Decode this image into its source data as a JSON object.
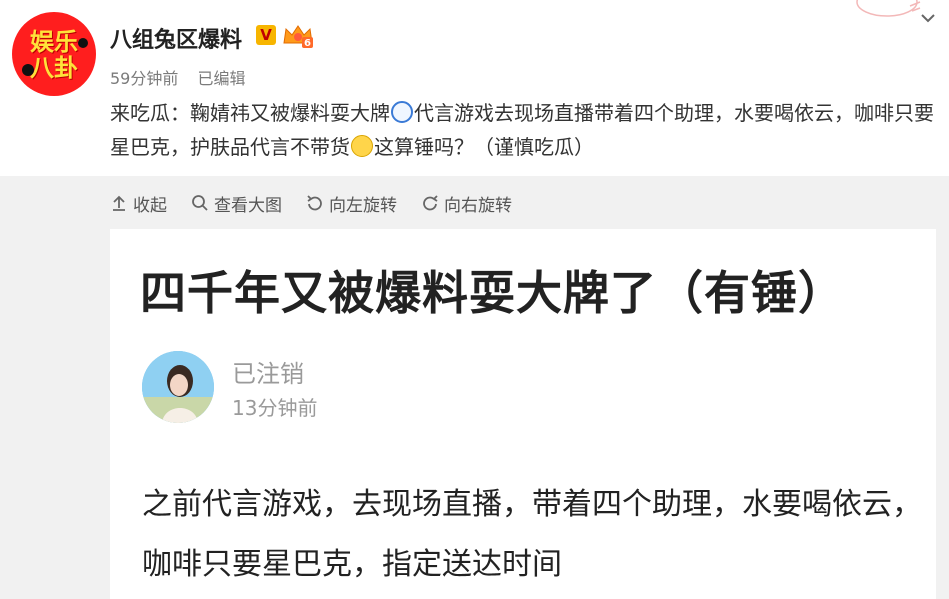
{
  "post": {
    "avatar_text": [
      "娱乐",
      "八卦"
    ],
    "author": "八组兔区爆料",
    "verified_badge": "V",
    "level_badge": "6",
    "time": "59分钟前",
    "edited": "已编辑",
    "text_parts": {
      "p1": "来吃瓜：鞠婧祎又被爆料耍大牌",
      "p2": "代言游戏去现场直播带着四个助理，水要喝依云，咖啡只要星巴克，护肤品代言不带货",
      "p3": "这算锤吗？（谨慎吃瓜）"
    },
    "icons": [
      "doraemon-emoji-icon",
      "thinking-face-emoji-icon"
    ],
    "accent_color": "#ff1e1e"
  },
  "toolbar": {
    "collapse": "收起",
    "view_large": "查看大图",
    "rotate_left": "向左旋转",
    "rotate_right": "向右旋转"
  },
  "image": {
    "title": "四千年又被爆料耍大牌了（有锤）",
    "author_name": "已注销",
    "author_time": "13分钟前",
    "body": "之前代言游戏，去现场直播，带着四个助理，水要喝依云，咖啡只要星巴克，指定送达时间"
  }
}
